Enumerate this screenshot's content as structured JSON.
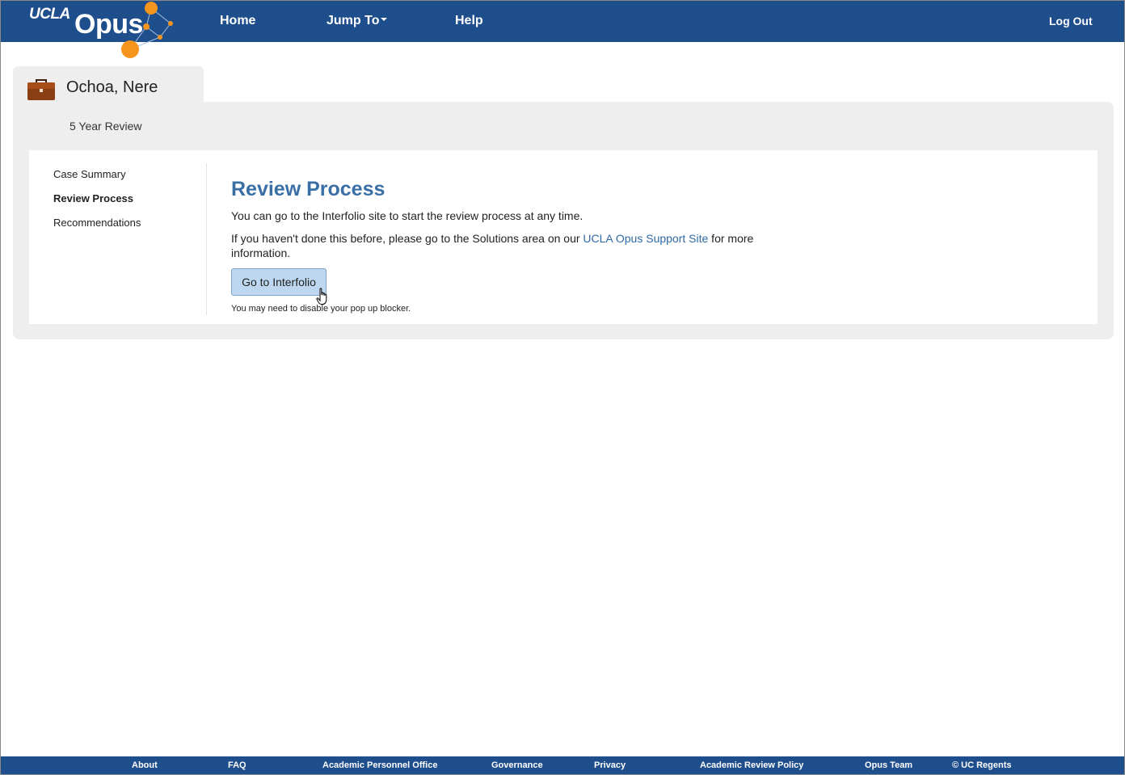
{
  "header": {
    "logo_prefix": "UCLA",
    "logo_name": "Opus",
    "nav": {
      "home": "Home",
      "jump_to": "Jump To",
      "help": "Help",
      "logout": "Log Out"
    }
  },
  "case": {
    "name": "Ochoa, Nere",
    "type": "5 Year Review"
  },
  "sidebar": {
    "items": [
      {
        "label": "Case Summary",
        "active": false
      },
      {
        "label": "Review Process",
        "active": true
      },
      {
        "label": "Recommendations",
        "active": false
      }
    ]
  },
  "main": {
    "title": "Review Process",
    "para1": "You can go to the Interfolio site to start the review process at any time.",
    "para2_before": "If you haven't done this before, please go to the Solutions area on our ",
    "para2_link": "UCLA Opus Support Site",
    "para2_after": " for more information.",
    "button_label": "Go to Interfolio",
    "note": "You may need to disable your pop up blocker."
  },
  "footer": {
    "links": [
      "About",
      "FAQ",
      "Academic Personnel Office",
      "Governance",
      "Privacy",
      "Academic Review Policy",
      "Opus Team",
      "© UC Regents"
    ]
  },
  "colors": {
    "nav_bg": "#1f4e8c",
    "accent_orange": "#f7941d",
    "title_blue": "#3a6fa6",
    "button_bg": "#bcd7ef",
    "panel_bg": "#eeeeee"
  },
  "icons": {
    "case": "briefcase-icon",
    "cursor": "hand-pointer-icon",
    "jump_to_caret": "caret-down-icon"
  }
}
